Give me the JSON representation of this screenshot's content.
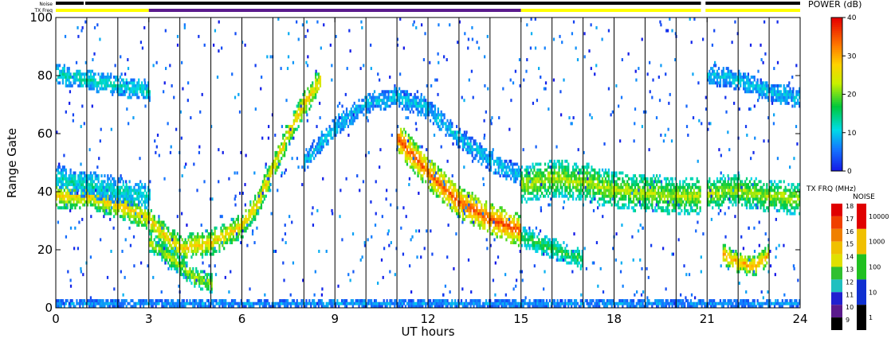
{
  "chart_data": {
    "type": "heatmap",
    "title": "",
    "xlabel": "UT hours",
    "ylabel": "Range Gate",
    "xlim": [
      0,
      24
    ],
    "ylim": [
      0,
      100
    ],
    "x_ticks": [
      0,
      3,
      6,
      9,
      12,
      15,
      18,
      21,
      24
    ],
    "x_tick_labels": [
      "0",
      "3",
      "6",
      "9",
      "12",
      "15",
      "18",
      "21",
      "24"
    ],
    "y_ticks": [
      0,
      20,
      40,
      60,
      80,
      100
    ],
    "y_tick_labels": [
      "0",
      "20",
      "40",
      "60",
      "80",
      "100"
    ],
    "grid": false,
    "scan_boundaries_ut": [
      1,
      2,
      3,
      4,
      5,
      6,
      7,
      8,
      9,
      10,
      11,
      12,
      13,
      14,
      15,
      16,
      17,
      18,
      19,
      20,
      21,
      22,
      23
    ],
    "noise_bar": {
      "label": "Noise",
      "segments": [
        {
          "start": 0,
          "end": 0.9,
          "color": "#000000"
        },
        {
          "start": 0.95,
          "end": 20.8,
          "color": "#000000"
        },
        {
          "start": 20.95,
          "end": 24,
          "color": "#000000"
        }
      ]
    },
    "txfreq_bar": {
      "label": "TX Freq",
      "segments": [
        {
          "start": 0,
          "end": 3,
          "color": "#ffff00"
        },
        {
          "start": 3,
          "end": 15,
          "color": "#5a1a8c"
        },
        {
          "start": 15,
          "end": 20.8,
          "color": "#ffff00"
        },
        {
          "start": 20.95,
          "end": 24,
          "color": "#ffff00"
        }
      ]
    },
    "features": [
      {
        "name": "low-band",
        "points": [
          [
            0,
            38
          ],
          [
            1,
            38
          ],
          [
            2,
            35
          ],
          [
            3,
            30
          ],
          [
            3.5,
            24
          ],
          [
            4,
            20
          ],
          [
            5,
            22
          ],
          [
            6,
            28
          ],
          [
            6.5,
            36
          ],
          [
            7,
            48
          ],
          [
            7.5,
            60
          ],
          [
            8,
            70
          ],
          [
            8.5,
            78
          ]
        ],
        "width": 4,
        "power": 22
      },
      {
        "name": "upper-band",
        "points": [
          [
            0,
            80
          ],
          [
            1,
            78
          ],
          [
            2,
            76
          ],
          [
            3,
            74
          ]
        ],
        "width": 3,
        "power": 10
      },
      {
        "name": "upper-band-2",
        "points": [
          [
            0,
            44
          ],
          [
            1,
            42
          ],
          [
            2,
            40
          ],
          [
            3,
            38
          ]
        ],
        "width": 4,
        "power": 10
      },
      {
        "name": "lower-arc",
        "points": [
          [
            3,
            22
          ],
          [
            4,
            14
          ],
          [
            4.5,
            10
          ],
          [
            5,
            8
          ]
        ],
        "width": 3,
        "power": 18
      },
      {
        "name": "dome",
        "points": [
          [
            8,
            50
          ],
          [
            9,
            62
          ],
          [
            10,
            70
          ],
          [
            11,
            72
          ],
          [
            12,
            68
          ],
          [
            13,
            58
          ],
          [
            14,
            50
          ],
          [
            15,
            45
          ]
        ],
        "width": 3,
        "power": 8
      },
      {
        "name": "dome-low",
        "points": [
          [
            11,
            58
          ],
          [
            12,
            46
          ],
          [
            13,
            36
          ],
          [
            14,
            30
          ],
          [
            15,
            26
          ]
        ],
        "width": 5,
        "power": 28
      },
      {
        "name": "evening-band",
        "points": [
          [
            15,
            42
          ],
          [
            16,
            44
          ],
          [
            17,
            43
          ],
          [
            18,
            40
          ],
          [
            19,
            39
          ],
          [
            20,
            38
          ],
          [
            20.8,
            38
          ]
        ],
        "width": 6,
        "power": 18
      },
      {
        "name": "evening-low",
        "points": [
          [
            15,
            24
          ],
          [
            16,
            20
          ],
          [
            17,
            16
          ]
        ],
        "width": 3,
        "power": 14
      },
      {
        "name": "late-band",
        "points": [
          [
            21,
            39
          ],
          [
            22,
            40
          ],
          [
            23,
            38
          ],
          [
            24,
            37
          ]
        ],
        "width": 5,
        "power": 18
      },
      {
        "name": "late-low",
        "points": [
          [
            21.5,
            18
          ],
          [
            22,
            15
          ],
          [
            22.5,
            14
          ],
          [
            23,
            18
          ]
        ],
        "width": 3,
        "power": 24
      },
      {
        "name": "late-top",
        "points": [
          [
            21,
            80
          ],
          [
            22,
            78
          ],
          [
            23,
            74
          ],
          [
            24,
            72
          ]
        ],
        "width": 3,
        "power": 8
      },
      {
        "name": "ground",
        "points": [
          [
            0,
            1
          ],
          [
            6,
            1
          ],
          [
            12,
            1
          ],
          [
            18,
            1
          ],
          [
            24,
            1
          ]
        ],
        "width": 1,
        "power": 6
      }
    ]
  },
  "colorbars": {
    "power": {
      "title": "POWER (dB)",
      "ticks": [
        "40",
        "30",
        "20",
        "10",
        "0"
      ]
    },
    "txfreq": {
      "title": "TX FRQ (MHz)",
      "ticks": [
        "18",
        "17",
        "16",
        "15",
        "14",
        "13",
        "12",
        "11",
        "10",
        "9"
      ],
      "colors": [
        "#e00000",
        "#f04000",
        "#f08000",
        "#f0c000",
        "#e0e000",
        "#30c030",
        "#20c0c0",
        "#2020d0",
        "#5a1a8c",
        "#000000"
      ]
    },
    "noise": {
      "title": "NOISE",
      "ticks": [
        "10000",
        "1000",
        "100",
        "10",
        "1"
      ],
      "colors": [
        "#e00000",
        "#f0c000",
        "#20c020",
        "#1030d0",
        "#000000"
      ]
    }
  }
}
